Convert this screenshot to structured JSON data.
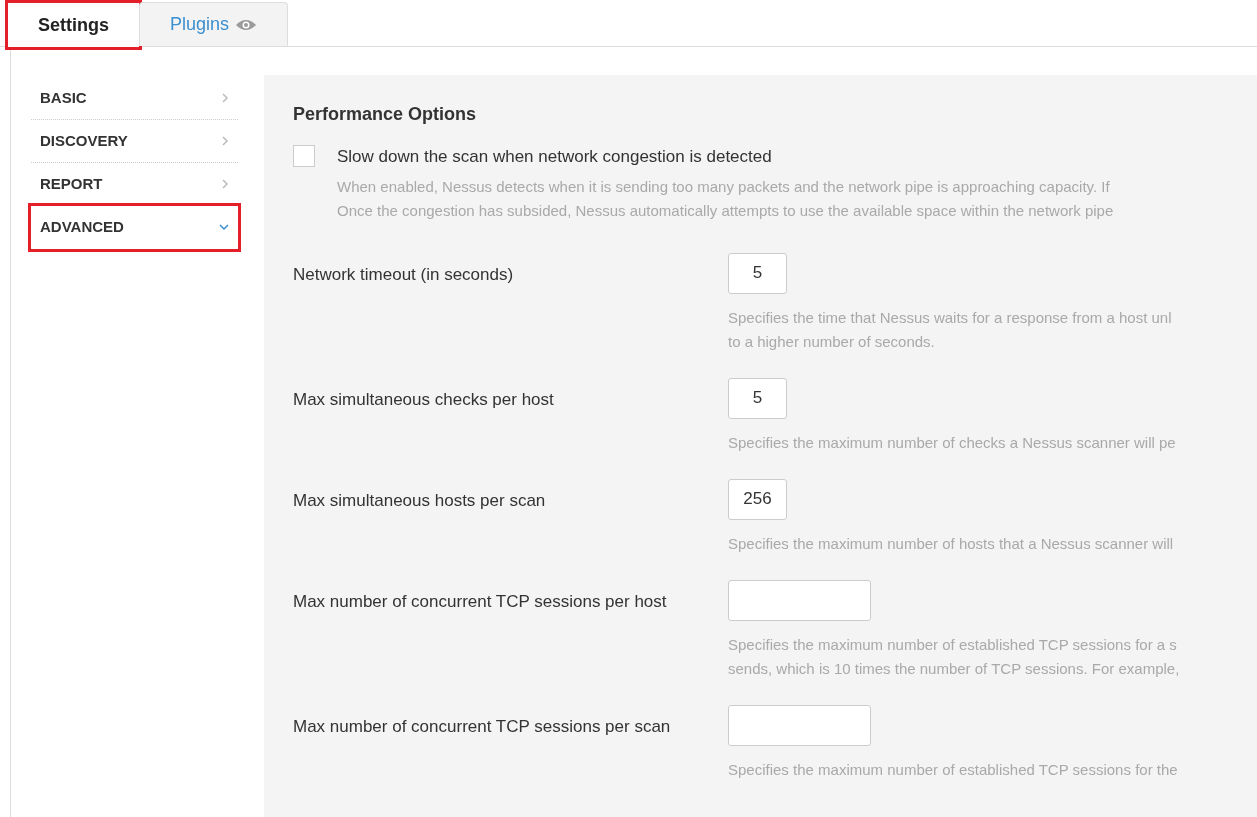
{
  "tabs": [
    {
      "label": "Settings",
      "selected": true,
      "highlighted": true,
      "kind": "text"
    },
    {
      "label": "Plugins",
      "selected": false,
      "highlighted": false,
      "kind": "with_icon"
    }
  ],
  "sidebar": {
    "items": [
      {
        "label": "BASIC",
        "expanded": false,
        "highlighted": false
      },
      {
        "label": "DISCOVERY",
        "expanded": false,
        "highlighted": false
      },
      {
        "label": "REPORT",
        "expanded": false,
        "highlighted": false
      },
      {
        "label": "ADVANCED",
        "expanded": true,
        "highlighted": true
      }
    ]
  },
  "section": {
    "title": "Performance Options",
    "checkbox": {
      "label": "Slow down the scan when network congestion is detected",
      "checked": false,
      "description": [
        "When enabled, Nessus detects when it is sending too many packets and the network pipe is approaching capacity. If",
        "Once the congestion has subsided, Nessus automatically attempts to use the available space within the network pipe"
      ]
    },
    "fields": [
      {
        "label": "Network timeout (in seconds)",
        "value": "5",
        "kind": "short",
        "description": [
          "Specifies the time that Nessus waits for a response from a host unl",
          "to a higher number of seconds."
        ]
      },
      {
        "label": "Max simultaneous checks per host",
        "value": "5",
        "kind": "short",
        "description": [
          "Specifies the maximum number of checks a Nessus scanner will pe"
        ]
      },
      {
        "label": "Max simultaneous hosts per scan",
        "value": "256",
        "kind": "short",
        "description": [
          "Specifies the maximum number of hosts that a Nessus scanner will"
        ]
      },
      {
        "label": "Max number of concurrent TCP sessions per host",
        "kind": "wide",
        "description": [
          "Specifies the maximum number of established TCP sessions for a s",
          "sends, which is 10 times the number of TCP sessions. For example,"
        ]
      },
      {
        "label": "Max number of concurrent TCP sessions per scan",
        "kind": "wide",
        "description": [
          "Specifies the maximum number of established TCP sessions for the"
        ]
      }
    ]
  }
}
